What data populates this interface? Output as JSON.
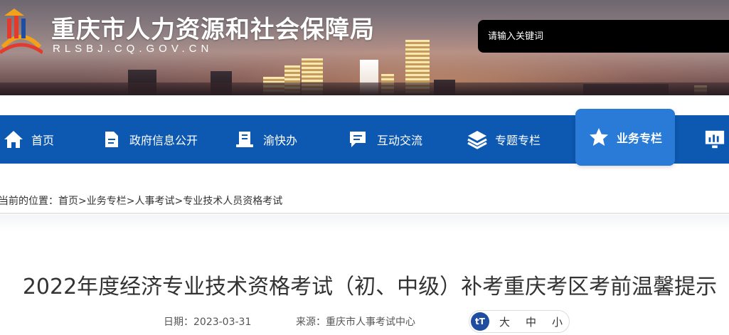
{
  "header": {
    "title": "重庆市人力资源和社会保障局",
    "domain": "RLSBJ.CQ.GOV.CN",
    "search_placeholder": "请输入关键词"
  },
  "nav": {
    "items": [
      {
        "label": "首页",
        "icon": "home-icon"
      },
      {
        "label": "政府信息公开",
        "icon": "document-icon"
      },
      {
        "label": "渝快办",
        "icon": "service-icon"
      },
      {
        "label": "互动交流",
        "icon": "chat-icon"
      },
      {
        "label": "专题专栏",
        "icon": "layers-icon"
      },
      {
        "label": "业务专栏",
        "icon": "star-icon",
        "active": true
      },
      {
        "label": "",
        "icon": "monitor-icon"
      }
    ]
  },
  "breadcrumb": {
    "prefix": "当前的位置：",
    "items": [
      "首页",
      "业务专栏",
      "人事考试",
      "专业技术人员资格考试"
    ],
    "separator": ">"
  },
  "article": {
    "title": "2022年度经济专业技术资格考试（初、中级）补考重庆考区考前温馨提示",
    "date_label": "日期：",
    "date": "2023-03-31",
    "source_label": "来源：",
    "source": "重庆市人事考试中心",
    "font_size_options": [
      "大",
      "中",
      "小"
    ],
    "font_toggle_glyph": "tT"
  },
  "colors": {
    "nav_bg": "#0d58b0",
    "nav_active_bg": "#2a7ad8",
    "search_bg": "#000000"
  }
}
